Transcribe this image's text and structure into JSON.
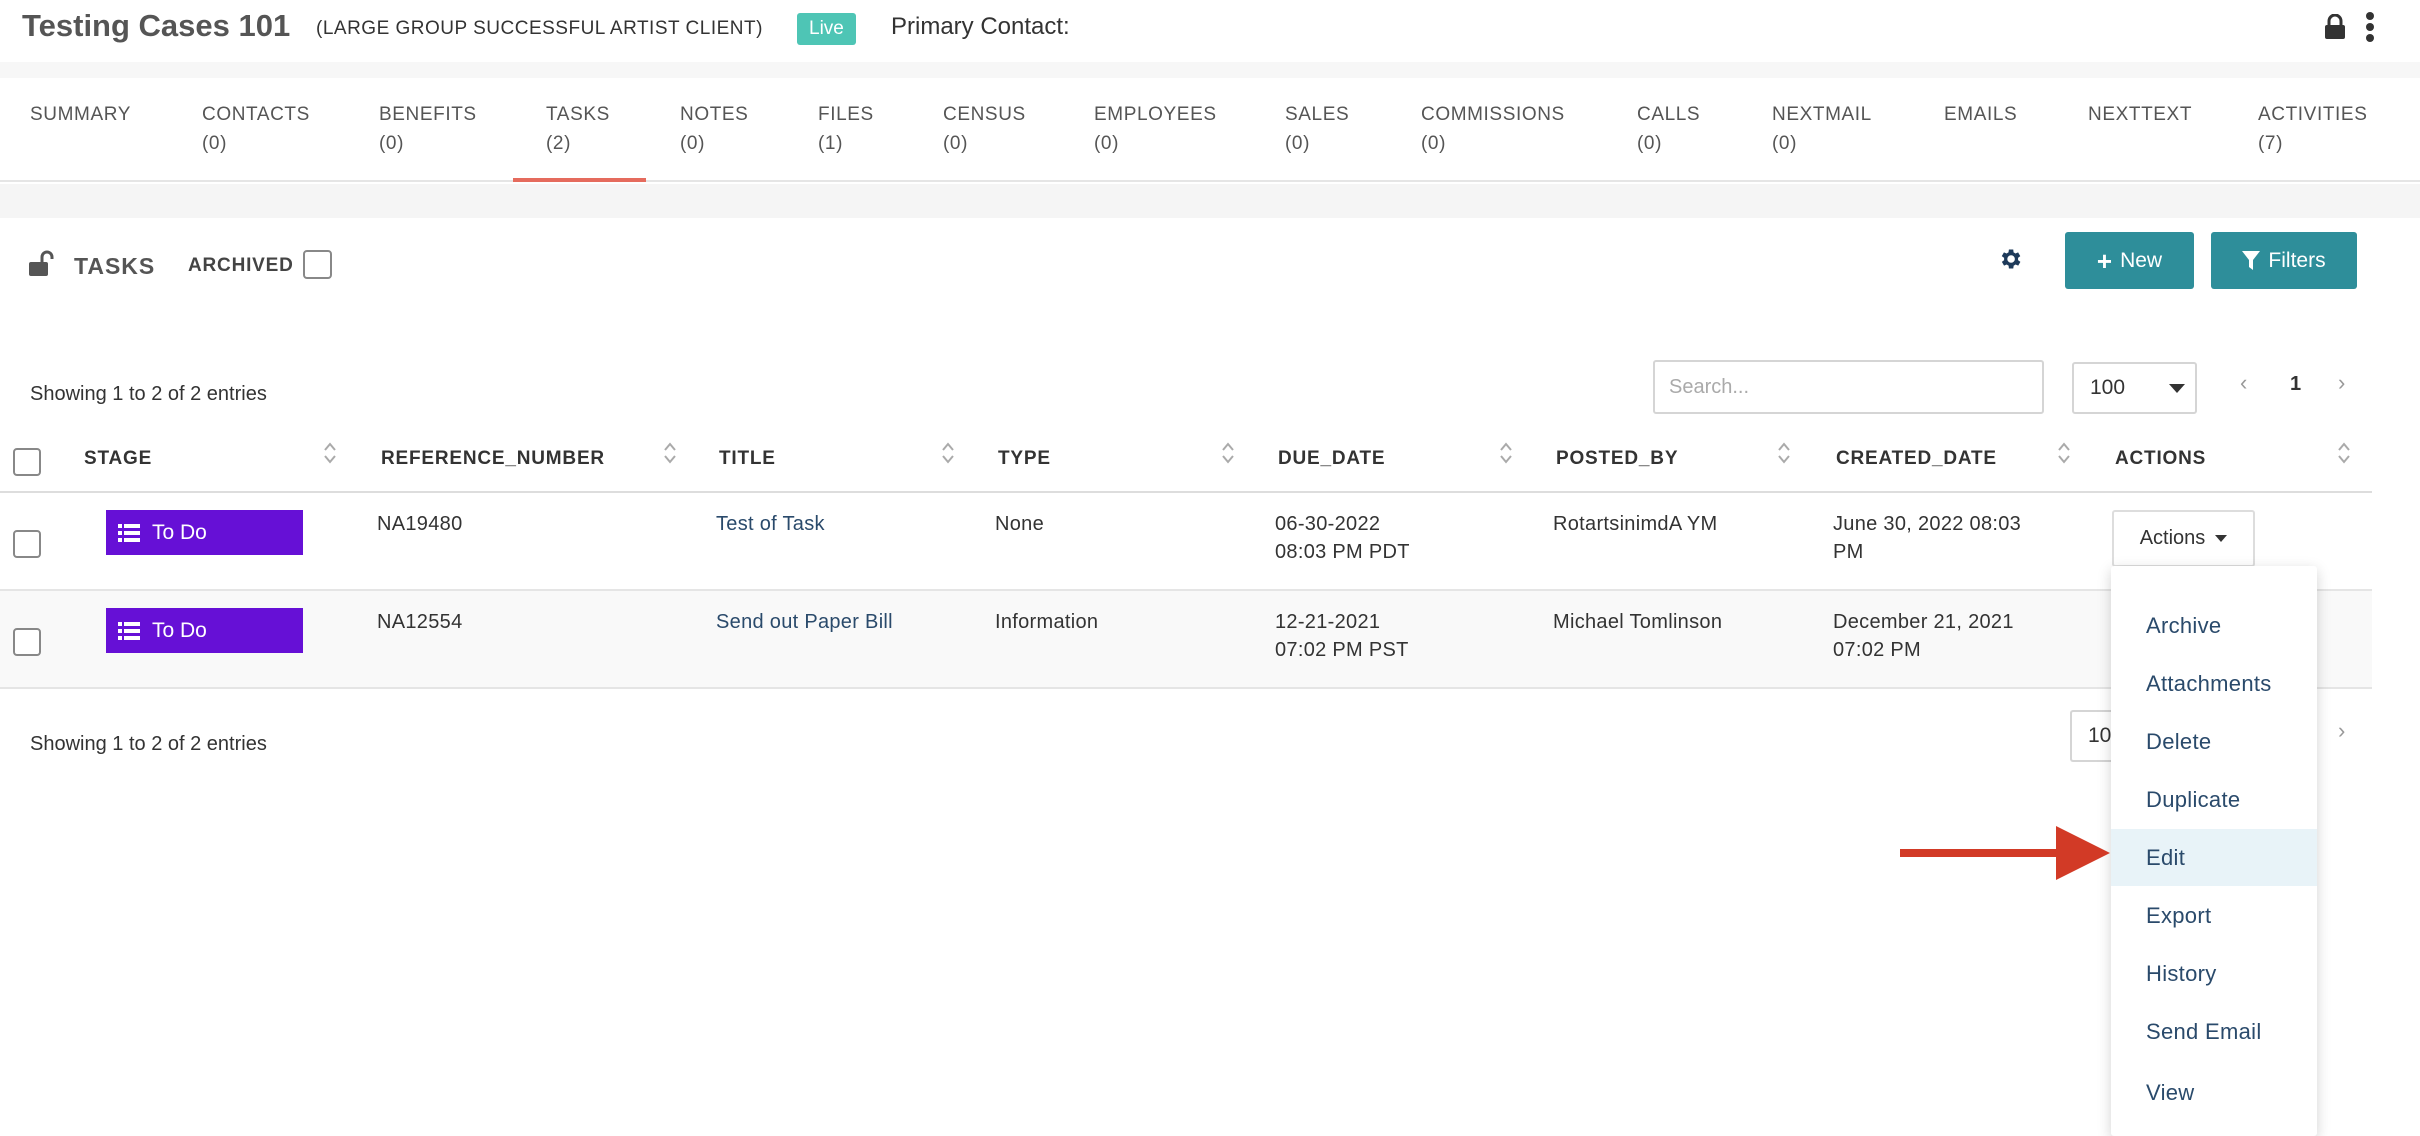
{
  "header": {
    "title": "Testing Cases 101",
    "client_type": "(LARGE GROUP SUCCESSFUL ARTIST CLIENT)",
    "status_badge": "Live",
    "primary_contact_label": "Primary Contact:"
  },
  "tabs": [
    {
      "label": "SUMMARY",
      "count": ""
    },
    {
      "label": "CONTACTS",
      "count": "(0)"
    },
    {
      "label": "BENEFITS",
      "count": "(0)"
    },
    {
      "label": "TASKS",
      "count": "(2)"
    },
    {
      "label": "NOTES",
      "count": "(0)"
    },
    {
      "label": "FILES",
      "count": "(1)"
    },
    {
      "label": "CENSUS",
      "count": "(0)"
    },
    {
      "label": "EMPLOYEES",
      "count": "(0)"
    },
    {
      "label": "SALES",
      "count": "(0)"
    },
    {
      "label": "COMMISSIONS",
      "count": "(0)"
    },
    {
      "label": "CALLS",
      "count": "(0)"
    },
    {
      "label": "NEXTMAIL",
      "count": "(0)"
    },
    {
      "label": "EMAILS",
      "count": ""
    },
    {
      "label": "NEXTTEXT",
      "count": ""
    },
    {
      "label": "ACTIVITIES",
      "count": "(7)"
    }
  ],
  "active_tab": "TASKS",
  "toolbar": {
    "section_title": "TASKS",
    "archived_label": "ARCHIVED",
    "new_label": "New",
    "filters_label": "Filters"
  },
  "table_controls": {
    "info_top": "Showing 1 to 2 of 2 entries",
    "info_bottom": "Showing 1 to 2 of 2 entries",
    "search_placeholder": "Search...",
    "page_size": "100",
    "page_size_bottom": "10",
    "current_page": "1",
    "prev": "‹",
    "next": "›"
  },
  "columns": [
    "STAGE",
    "REFERENCE_NUMBER",
    "TITLE",
    "TYPE",
    "DUE_DATE",
    "POSTED_BY",
    "CREATED_DATE",
    "ACTIONS"
  ],
  "rows": [
    {
      "stage": "To Do",
      "reference_number": "NA19480",
      "title": "Test of Task",
      "type": "None",
      "due_date_line1": "06-30-2022",
      "due_date_line2": "08:03 PM PDT",
      "posted_by": "RotartsinimdA YM",
      "created_date_line1": "June 30, 2022 08:03",
      "created_date_line2": "PM",
      "actions_label": "Actions"
    },
    {
      "stage": "To Do",
      "reference_number": "NA12554",
      "title": "Send out Paper Bill",
      "type": "Information",
      "due_date_line1": "12-21-2021",
      "due_date_line2": "07:02 PM PST",
      "posted_by": "Michael Tomlinson",
      "created_date_line1": "December 21, 2021",
      "created_date_line2": "07:02 PM"
    }
  ],
  "actions_menu": [
    "Archive",
    "Attachments",
    "Delete",
    "Duplicate",
    "Edit",
    "Export",
    "History",
    "Send Email",
    "View"
  ],
  "highlighted_action": "Edit",
  "colors": {
    "accent_teal": "#2e8e9a",
    "live_badge": "#4ec5b5",
    "stage_purple": "#6610d6",
    "tab_underline": "#e56b5d",
    "arrow_red": "#d23a26",
    "link": "#2a4a6b"
  },
  "icons": [
    "lock-icon",
    "kebab-menu-icon",
    "unlock-icon",
    "gear-icon",
    "plus-icon",
    "filter-icon",
    "list-icon",
    "sort-icon",
    "caret-down-icon",
    "red-arrow-icon"
  ]
}
